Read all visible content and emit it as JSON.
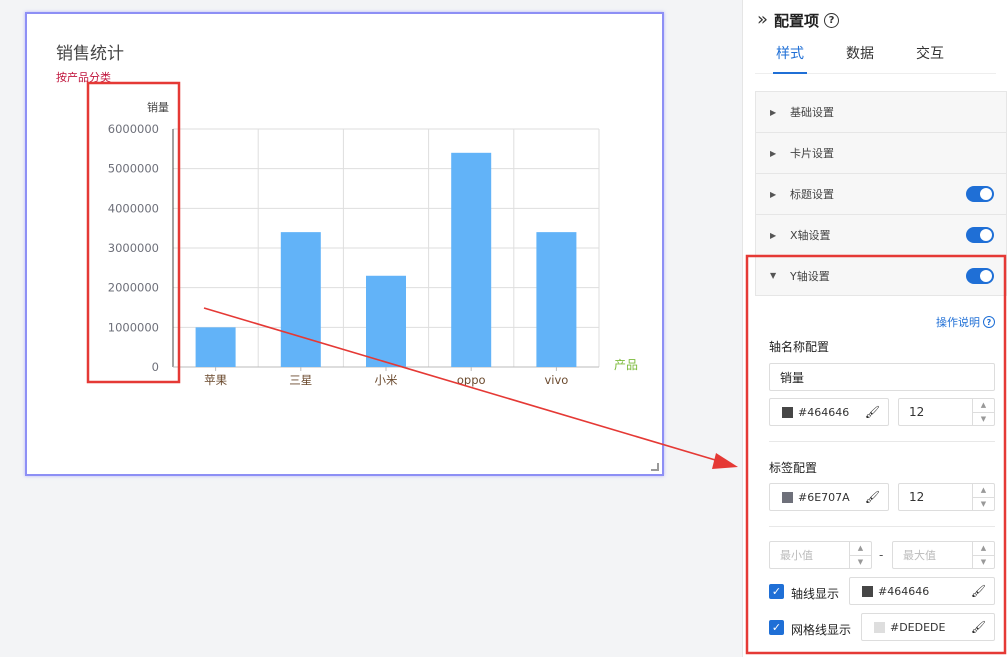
{
  "chart_data": {
    "type": "bar",
    "title": "销售统计",
    "subtitle": "按产品分类",
    "xlabel": "产品",
    "ylabel": "销量",
    "categories": [
      "苹果",
      "三星",
      "小米",
      "oppo",
      "vivo"
    ],
    "values": [
      1000000,
      3400000,
      2300000,
      5400000,
      3400000
    ],
    "ylim": [
      0,
      6000000
    ],
    "yticks": [
      0,
      1000000,
      2000000,
      3000000,
      4000000,
      5000000,
      6000000
    ],
    "grid": true,
    "colors": {
      "bar": "#62b3f8",
      "title": "#464646",
      "subtitle": "#c0143c",
      "xlabel": "#7cba3b",
      "axis": "#464646",
      "tick": "#6E707A",
      "grid": "#DEDEDE"
    }
  },
  "panel": {
    "title": "配置项",
    "collapse_icon": "double-chevron-right-icon",
    "tabs": [
      "样式",
      "数据",
      "交互"
    ],
    "active_tab": 0,
    "sections": [
      {
        "label": "基础设置",
        "toggle": false,
        "expanded": false
      },
      {
        "label": "卡片设置",
        "toggle": false,
        "expanded": false
      },
      {
        "label": "标题设置",
        "toggle": true,
        "expanded": false
      },
      {
        "label": "X轴设置",
        "toggle": true,
        "expanded": false
      },
      {
        "label": "Y轴设置",
        "toggle": true,
        "expanded": true
      }
    ],
    "yaxis": {
      "help_link": "操作说明",
      "axis_name_title": "轴名称配置",
      "axis_name_value": "销量",
      "axis_name_color": "#464646",
      "axis_name_size": "12",
      "label_title": "标签配置",
      "label_color": "#6E707A",
      "label_size": "12",
      "min_placeholder": "最小值",
      "max_placeholder": "最大值",
      "range_separator": "-",
      "axisline_label": "轴线显示",
      "axisline_checked": true,
      "axisline_color": "#464646",
      "gridline_label": "网格线显示",
      "gridline_checked": true,
      "gridline_color": "#DEDEDE"
    }
  },
  "annotation_color": "#e53935"
}
